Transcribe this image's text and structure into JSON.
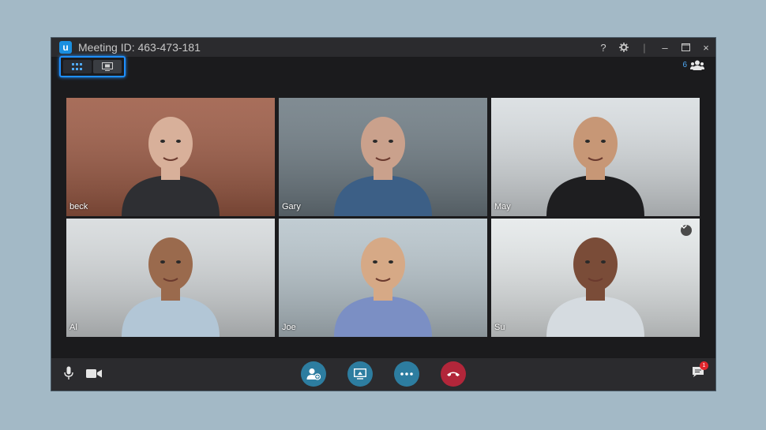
{
  "window": {
    "title": "Meeting ID: 463-473-181",
    "controls": {
      "help": "?",
      "minimize": "–",
      "close": "×"
    }
  },
  "participants": {
    "count": "6",
    "icon": "participants-icon"
  },
  "view_toggle": {
    "active": "grid-view",
    "icons": [
      "grid-view-icon",
      "speaker-view-icon"
    ]
  },
  "tiles": [
    {
      "name": "beck",
      "bg": "#9c5a44",
      "skin": "#d8b09a",
      "shirt": "#2e2f33"
    },
    {
      "name": "Gary",
      "bg": "#6f7c84",
      "skin": "#caa18c",
      "shirt": "#3c5f86"
    },
    {
      "name": "May",
      "bg": "#d8dde0",
      "skin": "#c79776",
      "shirt": "#1e1e20"
    },
    {
      "name": "Al",
      "bg": "#d6dadc",
      "skin": "#9a6a4d",
      "shirt": "#b2c6d6"
    },
    {
      "name": "Joe",
      "bg": "#b8c5cc",
      "skin": "#d6a986",
      "shirt": "#7b8fc4"
    },
    {
      "name": "Su",
      "bg": "#e5e9ea",
      "skin": "#7a4c38",
      "shirt": "#d5dbe0"
    }
  ],
  "toolbar": {
    "left": [
      "microphone-icon",
      "camera-icon"
    ],
    "center": [
      "invite-participant-icon",
      "share-screen-icon",
      "more-options-icon",
      "end-call-icon"
    ],
    "right": {
      "icon": "chat-icon",
      "badge": "1"
    }
  },
  "colors": {
    "accent": "#1e8fff",
    "action_blue": "#2d7da0",
    "end_call_red": "#b2263a"
  }
}
